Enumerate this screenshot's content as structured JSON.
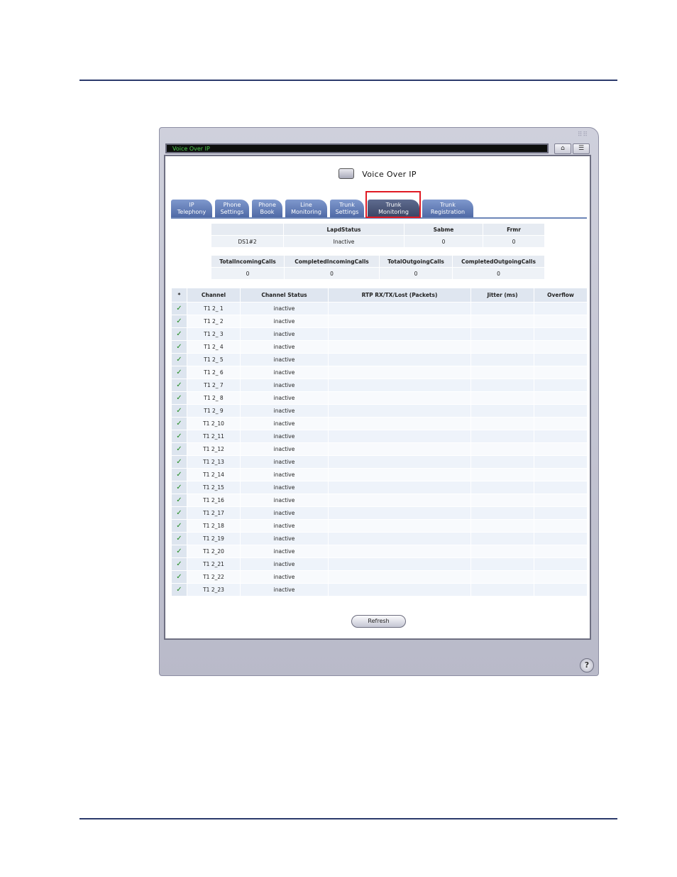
{
  "window": {
    "title": "Voice Over IP"
  },
  "header": {
    "title": "Voice Over IP"
  },
  "tabs": [
    {
      "line1": "IP",
      "line2": "Telephony"
    },
    {
      "line1": "Phone",
      "line2": "Settings"
    },
    {
      "line1": "Phone",
      "line2": "Book"
    },
    {
      "line1": "Line",
      "line2": "Monitoring"
    },
    {
      "line1": "Trunk",
      "line2": "Settings"
    },
    {
      "line1": "Trunk",
      "line2": "Monitoring"
    },
    {
      "line1": "Trunk",
      "line2": "Registration"
    }
  ],
  "active_tab": "Trunk Monitoring",
  "summary1": {
    "headers": [
      "",
      "LapdStatus",
      "Sabme",
      "Frmr"
    ],
    "row": [
      "DS1#2",
      "Inactive",
      "0",
      "0"
    ]
  },
  "summary2": {
    "headers": [
      "TotalIncomingCalls",
      "CompletedIncomingCalls",
      "TotalOutgoingCalls",
      "CompletedOutgoingCalls"
    ],
    "row": [
      "0",
      "0",
      "0",
      "0"
    ]
  },
  "channel_table": {
    "headers": [
      "*",
      "Channel",
      "Channel Status",
      "RTP RX/TX/Lost (Packets)",
      "Jitter (ms)",
      "Overflow"
    ],
    "check_symbol": "✓",
    "rows": [
      {
        "channel": "T1 2_ 1",
        "status": "inactive"
      },
      {
        "channel": "T1 2_ 2",
        "status": "inactive"
      },
      {
        "channel": "T1 2_ 3",
        "status": "inactive"
      },
      {
        "channel": "T1 2_ 4",
        "status": "inactive"
      },
      {
        "channel": "T1 2_ 5",
        "status": "inactive"
      },
      {
        "channel": "T1 2_ 6",
        "status": "inactive"
      },
      {
        "channel": "T1 2_ 7",
        "status": "inactive"
      },
      {
        "channel": "T1 2_ 8",
        "status": "inactive"
      },
      {
        "channel": "T1 2_ 9",
        "status": "inactive"
      },
      {
        "channel": "T1 2_10",
        "status": "inactive"
      },
      {
        "channel": "T1 2_11",
        "status": "inactive"
      },
      {
        "channel": "T1 2_12",
        "status": "inactive"
      },
      {
        "channel": "T1 2_13",
        "status": "inactive"
      },
      {
        "channel": "T1 2_14",
        "status": "inactive"
      },
      {
        "channel": "T1 2_15",
        "status": "inactive"
      },
      {
        "channel": "T1 2_16",
        "status": "inactive"
      },
      {
        "channel": "T1 2_17",
        "status": "inactive"
      },
      {
        "channel": "T1 2_18",
        "status": "inactive"
      },
      {
        "channel": "T1 2_19",
        "status": "inactive"
      },
      {
        "channel": "T1 2_20",
        "status": "inactive"
      },
      {
        "channel": "T1 2_21",
        "status": "inactive"
      },
      {
        "channel": "T1 2_22",
        "status": "inactive"
      },
      {
        "channel": "T1 2_23",
        "status": "inactive"
      }
    ]
  },
  "buttons": {
    "refresh": "Refresh",
    "help": "?"
  },
  "icons": {
    "network": "network-icon",
    "menu": "menu-icon",
    "voip": "voip-phone-icon",
    "help": "help-icon",
    "check": "check-icon"
  },
  "colors": {
    "tab": "#5f7ab8",
    "active_tab": "#4a5578",
    "highlight": "#e01b24",
    "check": "#1f8a1f",
    "page_rule": "#2b3a6b"
  }
}
